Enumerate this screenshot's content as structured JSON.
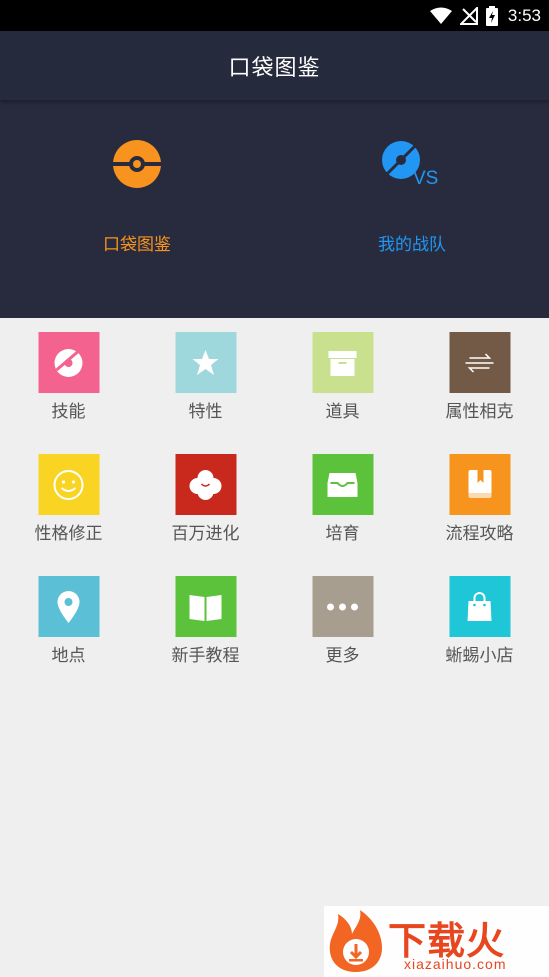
{
  "status_bar": {
    "time": "3:53"
  },
  "app_bar": {
    "title": "口袋图鉴"
  },
  "hero": {
    "left_label": "口袋图鉴",
    "right_label": "我的战队",
    "vs_text": "VS"
  },
  "grid": {
    "items": [
      {
        "label": "技能",
        "icon": "disc-icon",
        "color": "#f4628f"
      },
      {
        "label": "特性",
        "icon": "star-icon",
        "color": "#9fd8dc"
      },
      {
        "label": "道具",
        "icon": "box-icon",
        "color": "#c9e18f"
      },
      {
        "label": "属性相克",
        "icon": "swap-icon",
        "color": "#735a46"
      },
      {
        "label": "性格修正",
        "icon": "smiley-icon",
        "color": "#f9d423"
      },
      {
        "label": "百万进化",
        "icon": "flower-icon",
        "color": "#c8291c"
      },
      {
        "label": "培育",
        "icon": "tray-icon",
        "color": "#5dc23b"
      },
      {
        "label": "流程攻略",
        "icon": "book-icon",
        "color": "#f7941d"
      },
      {
        "label": "地点",
        "icon": "map-pin-icon",
        "color": "#5bbfd6"
      },
      {
        "label": "新手教程",
        "icon": "open-book-icon",
        "color": "#5dc23b"
      },
      {
        "label": "更多",
        "icon": "more-icon",
        "color": "#a89e90"
      },
      {
        "label": "蜥蜴小店",
        "icon": "shopping-bag-icon",
        "color": "#1ec6d8"
      }
    ]
  },
  "watermark": {
    "text": "下载火",
    "url": "xiazaihuo.com"
  }
}
